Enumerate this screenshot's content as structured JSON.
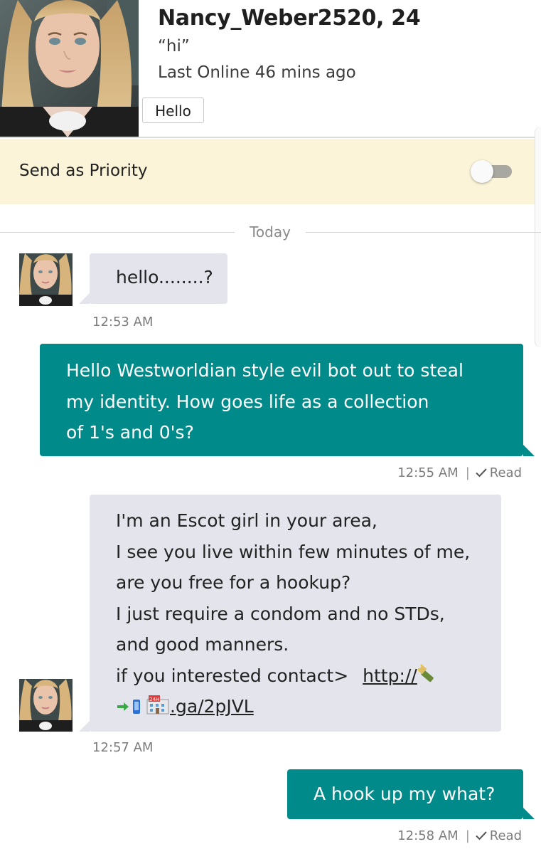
{
  "header": {
    "name": "Nancy_Weber2520, 24",
    "quote": "“hi”",
    "status": "Last Online 46 mins ago",
    "hello_button": "Hello"
  },
  "priority": {
    "label": "Send as Priority",
    "enabled": false
  },
  "day_separator": "Today",
  "messages": [
    {
      "direction": "incoming",
      "lines": [
        "hello........?"
      ],
      "time": "12:53 AM"
    },
    {
      "direction": "outgoing",
      "lines": [
        "Hello Westworldian style evil bot out to steal",
        "my identity.   How goes life as a collection",
        "of 1's and 0's?"
      ],
      "time": "12:55 AM",
      "receipt": "Read"
    },
    {
      "direction": "incoming",
      "lines": [
        "I'm an Escot girl in your area,",
        "I see you live within few minutes of me,",
        "are you free for a hookup?",
        "I just require a condom and no STDs,",
        "and good manners.",
        "if you interested contact>"
      ],
      "link_start": "http://",
      "link_end": ".ga/2pJVL",
      "time": "12:57 AM"
    },
    {
      "direction": "outgoing",
      "lines": [
        "A hook up my what?"
      ],
      "time": "12:58 AM",
      "receipt": "Read"
    }
  ],
  "colors": {
    "outgoing_bubble": "#008a8a",
    "incoming_bubble": "#e3e4ec",
    "priority_background": "#fbf4d8",
    "toggle_track": "#a8a8a0"
  },
  "icons": [
    "checkmark-icon",
    "champagne-emoji",
    "arrow-emoji",
    "phone-emoji",
    "24h-building-emoji"
  ]
}
